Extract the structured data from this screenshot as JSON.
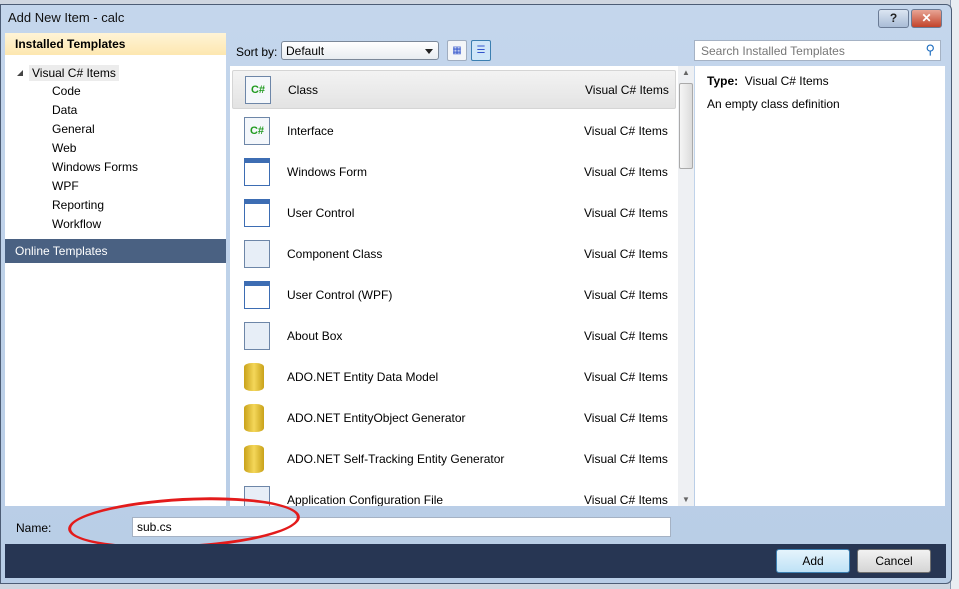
{
  "window": {
    "title": "Add New Item - calc",
    "help_label": "?",
    "close_label": "✕"
  },
  "left": {
    "installed_header": "Installed Templates",
    "root": "Visual C# Items",
    "items": [
      "Code",
      "Data",
      "General",
      "Web",
      "Windows Forms",
      "WPF",
      "Reporting",
      "Workflow"
    ],
    "online": "Online Templates"
  },
  "toolbar": {
    "sort_label": "Sort by:",
    "sort_value": "Default",
    "search_placeholder": "Search Installed Templates"
  },
  "templates": [
    {
      "name": "Class",
      "category": "Visual C# Items",
      "icon": "csharp-file-icon",
      "selected": true
    },
    {
      "name": "Interface",
      "category": "Visual C# Items",
      "icon": "interface-icon"
    },
    {
      "name": "Windows Form",
      "category": "Visual C# Items",
      "icon": "windows-form-icon"
    },
    {
      "name": "User Control",
      "category": "Visual C# Items",
      "icon": "user-control-icon"
    },
    {
      "name": "Component Class",
      "category": "Visual C# Items",
      "icon": "component-class-icon"
    },
    {
      "name": "User Control (WPF)",
      "category": "Visual C# Items",
      "icon": "wpf-user-control-icon"
    },
    {
      "name": "About Box",
      "category": "Visual C# Items",
      "icon": "about-box-icon"
    },
    {
      "name": "ADO.NET Entity Data Model",
      "category": "Visual C# Items",
      "icon": "database-icon"
    },
    {
      "name": "ADO.NET EntityObject Generator",
      "category": "Visual C# Items",
      "icon": "database-icon"
    },
    {
      "name": "ADO.NET Self-Tracking Entity Generator",
      "category": "Visual C# Items",
      "icon": "database-icon"
    },
    {
      "name": "Application Configuration File",
      "category": "Visual C# Items",
      "icon": "config-file-icon"
    }
  ],
  "details": {
    "type_label": "Type:",
    "type_value": "Visual C# Items",
    "description": "An empty class definition"
  },
  "name_field": {
    "label": "Name:",
    "value": "sub.cs"
  },
  "buttons": {
    "add": "Add",
    "cancel": "Cancel"
  },
  "annotation_color": "#e31b1b"
}
